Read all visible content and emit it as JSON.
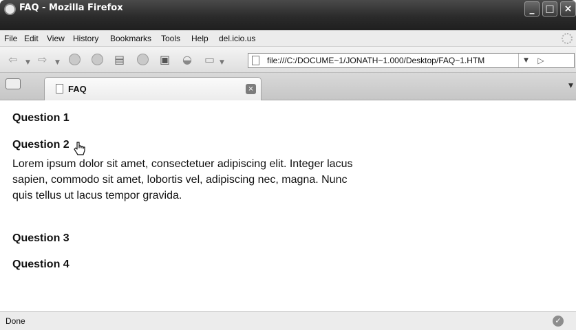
{
  "window": {
    "title": "FAQ - Mozilla Firefox"
  },
  "menu": [
    "File",
    "Edit",
    "View",
    "History",
    "Bookmarks",
    "Tools",
    "Help",
    "del.icio.us"
  ],
  "urlbar": {
    "url": "file:///C:/DOCUME~1/JONATH~1.000/Desktop/FAQ~1.HTM"
  },
  "tab": {
    "label": "FAQ"
  },
  "content": {
    "questions": [
      "Question 1",
      "Question 2",
      "Question 3",
      "Question 4"
    ],
    "answer": "Lorem ipsum dolor sit amet, consectetuer adipiscing elit. Integer lacus sapien, commodo sit amet, lobortis vel, adipiscing nec, magna. Nunc quis tellus ut lacus tempor gravida."
  },
  "status": {
    "text": "Done"
  },
  "icons": [
    "firefox-icon",
    "back-icon",
    "forward-icon",
    "reload-icon",
    "stop-icon",
    "print-icon",
    "history-icon",
    "screenshot-icon",
    "tag-icon",
    "bookmark-icon",
    "page-icon",
    "go-icon",
    "new-tab-icon",
    "tab-close-icon",
    "hand-cursor-icon",
    "check-icon"
  ]
}
